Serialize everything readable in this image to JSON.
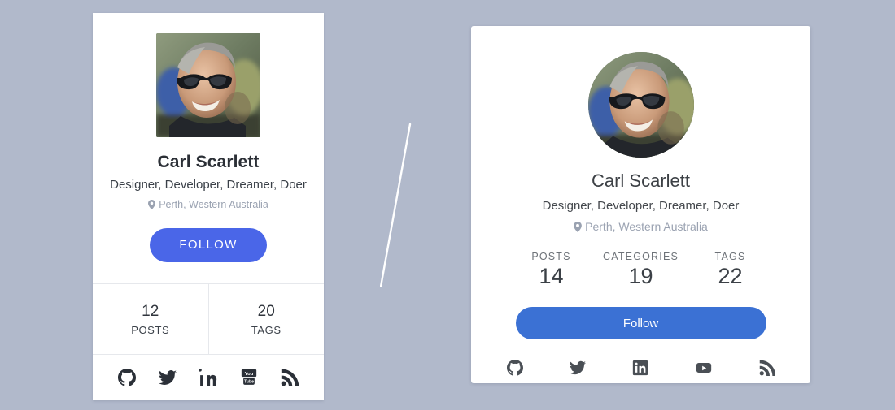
{
  "page": {
    "background_color": "#b1b9cb",
    "divider_color": "#ffffff"
  },
  "left_card": {
    "background_color": "#ffffff",
    "avatar": {
      "alt": "Carl Scarlett portrait photo, man with sunglasses",
      "shape": "square"
    },
    "name": "Carl Scarlett",
    "tagline": "Designer, Developer, Dreamer, Doer",
    "location": "Perth, Western Australia",
    "location_icon": "map-pin-icon",
    "follow_label": "FOLLOW",
    "follow_color": "#4a66e8",
    "stats": [
      {
        "value": "12",
        "label": "POSTS"
      },
      {
        "value": "20",
        "label": "TAGS"
      }
    ],
    "socials": [
      {
        "name": "github",
        "title": "GitHub"
      },
      {
        "name": "twitter",
        "title": "Twitter"
      },
      {
        "name": "linkedin",
        "title": "LinkedIn"
      },
      {
        "name": "youtube",
        "title": "YouTube"
      },
      {
        "name": "rss",
        "title": "RSS Feed"
      }
    ]
  },
  "right_card": {
    "background_color": "#ffffff",
    "avatar": {
      "alt": "Carl Scarlett portrait photo, man with sunglasses",
      "shape": "circle"
    },
    "name": "Carl Scarlett",
    "tagline": "Designer, Developer, Dreamer, Doer",
    "location": "Perth, Western Australia",
    "location_icon": "map-pin-icon",
    "follow_label": "Follow",
    "follow_color": "#3b71d4",
    "stats": [
      {
        "label": "POSTS",
        "value": "14"
      },
      {
        "label": "CATEGORIES",
        "value": "19"
      },
      {
        "label": "TAGS",
        "value": "22"
      }
    ],
    "socials": [
      {
        "name": "github",
        "title": "GitHub"
      },
      {
        "name": "twitter",
        "title": "Twitter"
      },
      {
        "name": "linkedin",
        "title": "LinkedIn"
      },
      {
        "name": "youtube",
        "title": "YouTube"
      },
      {
        "name": "rss",
        "title": "RSS Feed"
      }
    ]
  }
}
